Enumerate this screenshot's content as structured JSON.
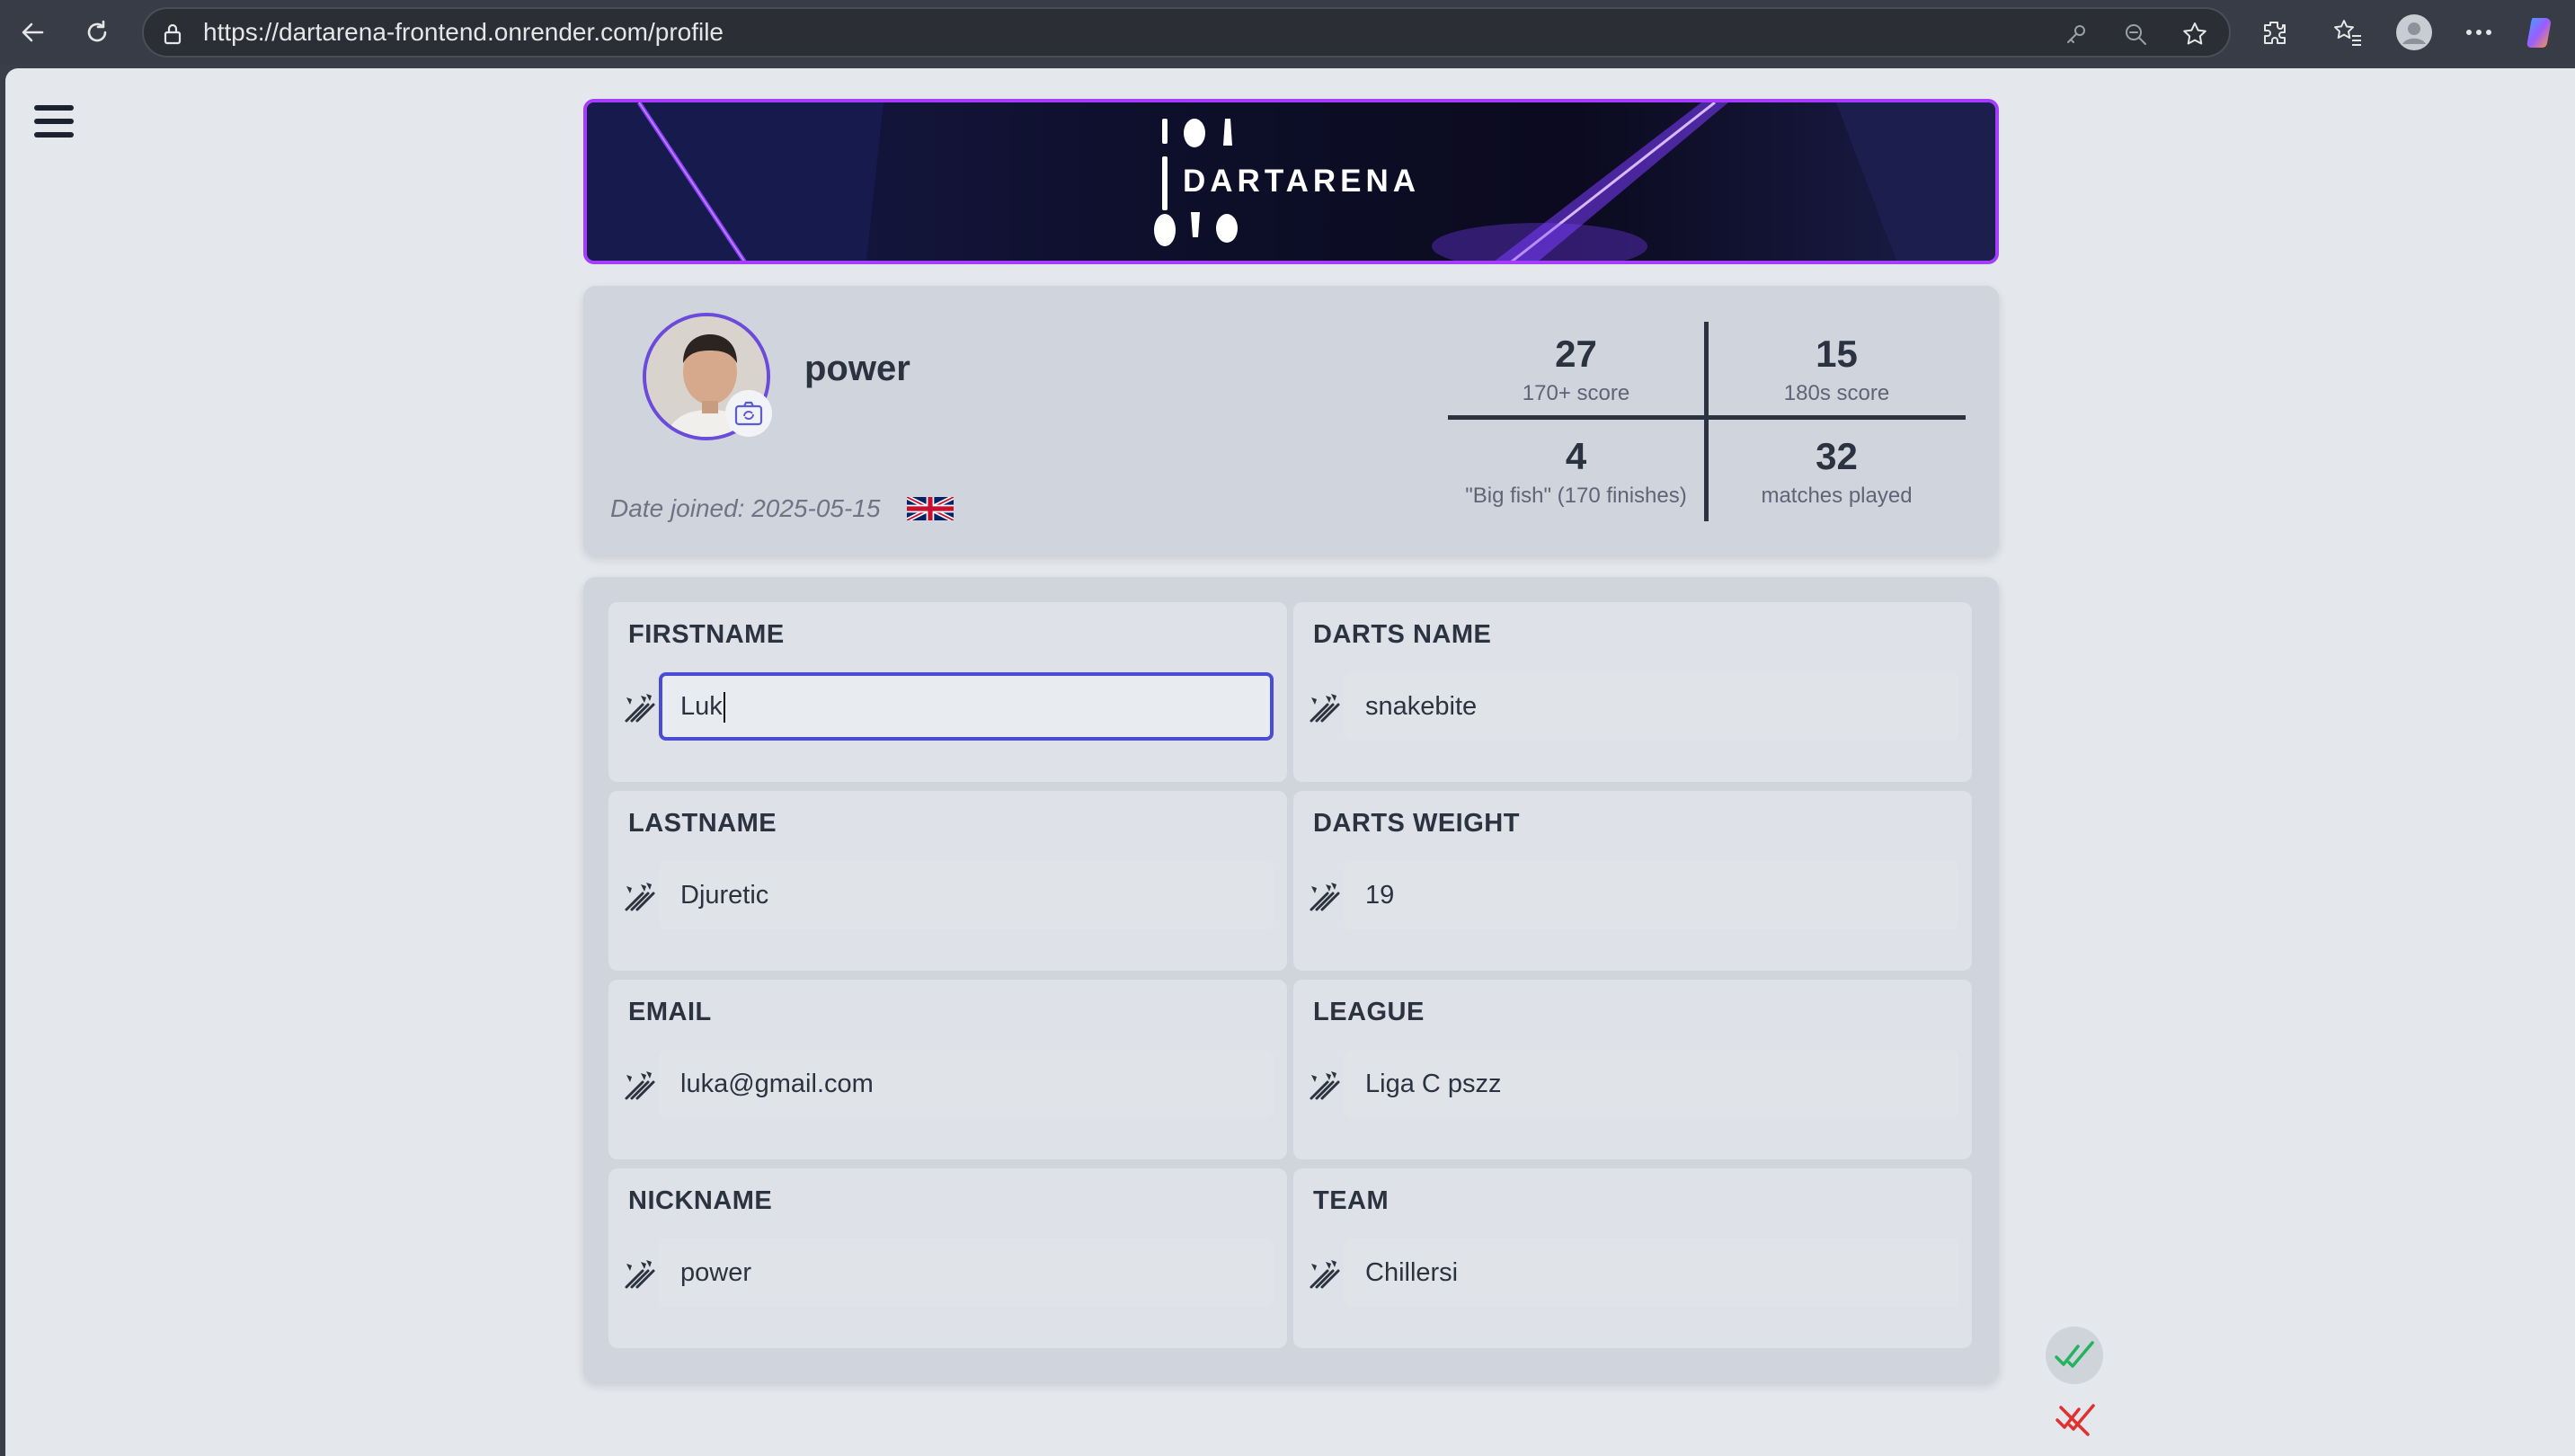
{
  "browser": {
    "url": "https://dartarena-frontend.onrender.com/profile",
    "icons": [
      "back-icon",
      "refresh-icon",
      "lock-icon",
      "key-icon",
      "zoom-out-icon",
      "star-icon",
      "extensions-icon",
      "favorites-icon",
      "profile-icon",
      "more-icon",
      "copilot-icon"
    ]
  },
  "banner": {
    "title": "DARTARENA"
  },
  "profile": {
    "username": "power",
    "date_joined": "Date joined: 2025-05-15",
    "country_flag": "flag-uk-icon",
    "stats": [
      {
        "value": "27",
        "label": "170+ score"
      },
      {
        "value": "15",
        "label": "180s score"
      },
      {
        "value": "4",
        "label": "\"Big fish\" (170 finishes)"
      },
      {
        "value": "32",
        "label": "matches played"
      }
    ]
  },
  "form": {
    "fields": [
      {
        "label": "FIRSTNAME",
        "value": "Luk",
        "active": true
      },
      {
        "label": "DARTS NAME",
        "value": "snakebite"
      },
      {
        "label": "LASTNAME",
        "value": "Djuretic"
      },
      {
        "label": "DARTS WEIGHT",
        "value": "19"
      },
      {
        "label": "EMAIL",
        "value": "luka@gmail.com"
      },
      {
        "label": "LEAGUE",
        "value": "Liga C pszz"
      },
      {
        "label": "NICKNAME",
        "value": "power"
      },
      {
        "label": "TEAM",
        "value": "Chillersi"
      }
    ]
  },
  "colors": {
    "accent": "#4b4bd6",
    "banner_border": "#a53cff",
    "confirm": "#22b35e",
    "cancel": "#e03131"
  }
}
